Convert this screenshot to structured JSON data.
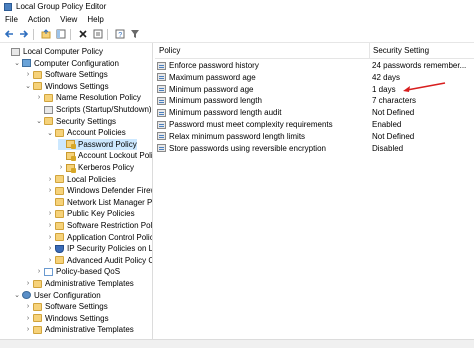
{
  "window": {
    "title": "Local Group Policy Editor"
  },
  "menu": [
    "File",
    "Action",
    "View",
    "Help"
  ],
  "toolbar": {
    "icons": [
      "back-arrow-icon",
      "forward-arrow-icon",
      "up-folder-icon",
      "show-hide-tree-icon",
      "delete-icon",
      "properties-icon",
      "help-icon",
      "filter-icon"
    ]
  },
  "tree": [
    {
      "label": "Local Computer Policy",
      "depth": 0,
      "chev": "",
      "icon": "policy"
    },
    {
      "label": "Computer Configuration",
      "depth": 1,
      "chev": "v",
      "icon": "computer"
    },
    {
      "label": "Software Settings",
      "depth": 2,
      "chev": ">",
      "icon": "folder"
    },
    {
      "label": "Windows Settings",
      "depth": 2,
      "chev": "v",
      "icon": "folder"
    },
    {
      "label": "Name Resolution Policy",
      "depth": 3,
      "chev": ">",
      "icon": "folder"
    },
    {
      "label": "Scripts (Startup/Shutdown)",
      "depth": 3,
      "chev": "",
      "icon": "policy"
    },
    {
      "label": "Security Settings",
      "depth": 3,
      "chev": "v",
      "icon": "folder"
    },
    {
      "label": "Account Policies",
      "depth": 4,
      "chev": "v",
      "icon": "folder"
    },
    {
      "label": "Password Policy",
      "depth": 5,
      "chev": "",
      "icon": "lock",
      "selected": true
    },
    {
      "label": "Account Lockout Policy",
      "depth": 5,
      "chev": "",
      "icon": "lock"
    },
    {
      "label": "Kerberos Policy",
      "depth": 5,
      "chev": ">",
      "icon": "lock"
    },
    {
      "label": "Local Policies",
      "depth": 4,
      "chev": ">",
      "icon": "folder"
    },
    {
      "label": "Windows Defender Firewall",
      "depth": 4,
      "chev": ">",
      "icon": "folder"
    },
    {
      "label": "Network List Manager Policies",
      "depth": 4,
      "chev": "",
      "icon": "folder"
    },
    {
      "label": "Public Key Policies",
      "depth": 4,
      "chev": ">",
      "icon": "folder"
    },
    {
      "label": "Software Restriction Policies",
      "depth": 4,
      "chev": ">",
      "icon": "folder"
    },
    {
      "label": "Application Control Policies",
      "depth": 4,
      "chev": ">",
      "icon": "folder"
    },
    {
      "label": "IP Security Policies on Local",
      "depth": 4,
      "chev": ">",
      "icon": "shield"
    },
    {
      "label": "Advanced Audit Policy Cont",
      "depth": 4,
      "chev": ">",
      "icon": "folder"
    },
    {
      "label": "Policy-based QoS",
      "depth": 3,
      "chev": ">",
      "icon": "chart"
    },
    {
      "label": "Administrative Templates",
      "depth": 2,
      "chev": ">",
      "icon": "folder"
    },
    {
      "label": "User Configuration",
      "depth": 1,
      "chev": "v",
      "icon": "user"
    },
    {
      "label": "Software Settings",
      "depth": 2,
      "chev": ">",
      "icon": "folder"
    },
    {
      "label": "Windows Settings",
      "depth": 2,
      "chev": ">",
      "icon": "folder"
    },
    {
      "label": "Administrative Templates",
      "depth": 2,
      "chev": ">",
      "icon": "folder"
    }
  ],
  "details": {
    "columns": {
      "policy": "Policy",
      "setting": "Security Setting"
    },
    "rows": [
      {
        "policy": "Enforce password history",
        "setting": "24 passwords remember..."
      },
      {
        "policy": "Maximum password age",
        "setting": "42 days"
      },
      {
        "policy": "Minimum password age",
        "setting": "1 days"
      },
      {
        "policy": "Minimum password length",
        "setting": "7 characters"
      },
      {
        "policy": "Minimum password length audit",
        "setting": "Not Defined"
      },
      {
        "policy": "Password must meet complexity requirements",
        "setting": "Enabled"
      },
      {
        "policy": "Relax minimum password length limits",
        "setting": "Not Defined"
      },
      {
        "policy": "Store passwords using reversible encryption",
        "setting": "Disabled"
      }
    ]
  },
  "annotation": {
    "arrow_color": "#d81e1e"
  }
}
